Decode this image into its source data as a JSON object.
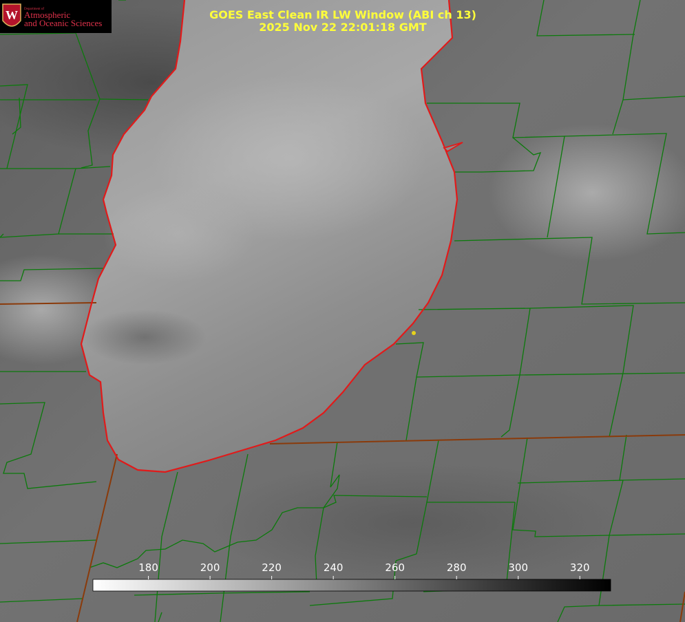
{
  "title": {
    "line1": "GOES East Clean IR LW Window (ABI ch 13)",
    "line2": "2025 Nov 22 22:01:18 GMT"
  },
  "logo": {
    "small": "Department of",
    "line1": "Atmospheric",
    "line2": "and Oceanic Sciences",
    "letter": "W"
  },
  "colorbar": {
    "min": 162,
    "max": 330,
    "ticks": [
      "180",
      "200",
      "220",
      "240",
      "260",
      "280",
      "300",
      "320"
    ],
    "colors": {
      "low": "#ffffff",
      "high": "#000000"
    }
  },
  "colors": {
    "county_lines": "#0b7a0b",
    "state_lines": "#8a3a0a",
    "lake_outline": "#e11a1a",
    "marker": "#e6d21c",
    "title": "#ffff3a"
  }
}
